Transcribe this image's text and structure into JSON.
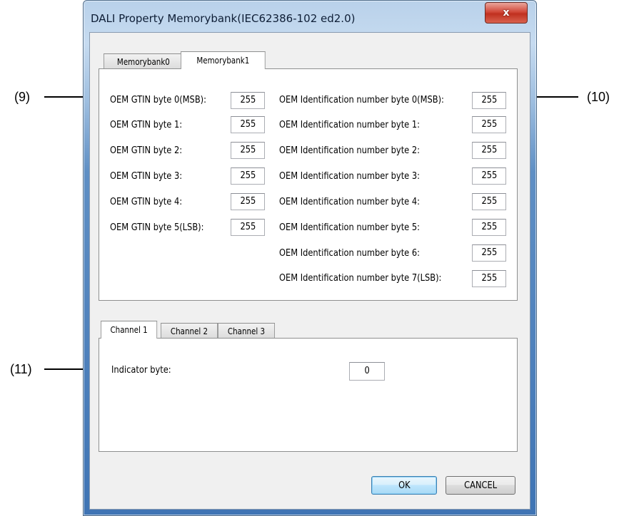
{
  "window": {
    "title": "DALI Property Memorybank(IEC62386-102 ed2.0)",
    "close_glyph": "x"
  },
  "callouts": {
    "left_top": "(9)",
    "right_top": "(10)",
    "left_bottom": "(11)"
  },
  "memory_tabs": [
    "Memorybank0",
    "Memorybank1"
  ],
  "gtin": [
    {
      "label": "OEM GTIN byte 0(MSB):",
      "value": "255"
    },
    {
      "label": "OEM GTIN byte 1:",
      "value": "255"
    },
    {
      "label": "OEM GTIN byte 2:",
      "value": "255"
    },
    {
      "label": "OEM GTIN byte 3:",
      "value": "255"
    },
    {
      "label": "OEM GTIN byte 4:",
      "value": "255"
    },
    {
      "label": "OEM GTIN byte 5(LSB):",
      "value": "255"
    }
  ],
  "oem_id": [
    {
      "label": "OEM Identification number byte 0(MSB):",
      "value": "255"
    },
    {
      "label": "OEM Identification number byte 1:",
      "value": "255"
    },
    {
      "label": "OEM Identification number byte 2:",
      "value": "255"
    },
    {
      "label": "OEM Identification number byte 3:",
      "value": "255"
    },
    {
      "label": "OEM Identification number byte 4:",
      "value": "255"
    },
    {
      "label": "OEM Identification number byte 5:",
      "value": "255"
    },
    {
      "label": "OEM Identification number byte 6:",
      "value": "255"
    },
    {
      "label": "OEM Identification number byte 7(LSB):",
      "value": "255"
    }
  ],
  "channel_tabs": [
    "Channel 1",
    "Channel 2",
    "Channel 3"
  ],
  "indicator": {
    "label": "Indicator byte:",
    "value": "0"
  },
  "buttons": {
    "ok": "OK",
    "cancel": "CANCEL"
  }
}
